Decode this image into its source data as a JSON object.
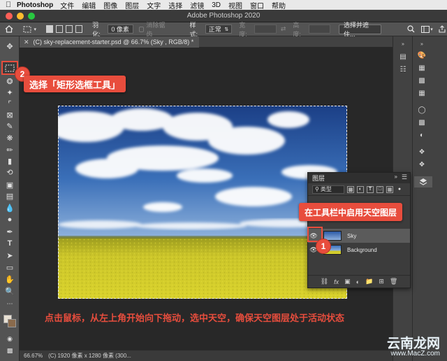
{
  "menubar": {
    "apple": "",
    "app_name": "Photoshop",
    "items": [
      "文件",
      "编辑",
      "图像",
      "图层",
      "文字",
      "选择",
      "滤镜",
      "3D",
      "视图",
      "窗口",
      "帮助"
    ]
  },
  "titlebar": {
    "title": "Adobe Photoshop 2020"
  },
  "options": {
    "feather_label": "羽化:",
    "feather_value": "0 像素",
    "antialias_label": "消除锯齿",
    "style_label": "样式:",
    "style_value": "正常",
    "width_label": "宽度:",
    "height_label": "高度:",
    "select_mask_button": "选择并遮住..."
  },
  "document": {
    "tab_title": "(C) sky-replacement-starter.psd @ 66.7% (Sky , RGB/8) *"
  },
  "status": {
    "zoom": "66.67%",
    "doc_info": "(C) 1920 像素 x 1280 像素 (300..."
  },
  "layers_panel": {
    "title": "图层",
    "filter_kind": "类型",
    "layers": [
      {
        "name": "Sky",
        "selected": true
      },
      {
        "name": "Background",
        "selected": false
      }
    ]
  },
  "callouts": {
    "step2_number": "2",
    "step2_text": "选择「矩形选框工具」",
    "step1_number": "1",
    "step1_text": "在工具栏中启用天空图层",
    "bottom_note": "点击鼠标，从左上角开始向下拖动，选中天空，确保天空图层处于活动状态"
  },
  "watermark": {
    "text_big": "云南龙网",
    "text_small": "www.MacZ.com"
  },
  "colors": {
    "accent": "#e84d3d",
    "panel_bg": "#424242",
    "canvas_bg": "#282828"
  }
}
